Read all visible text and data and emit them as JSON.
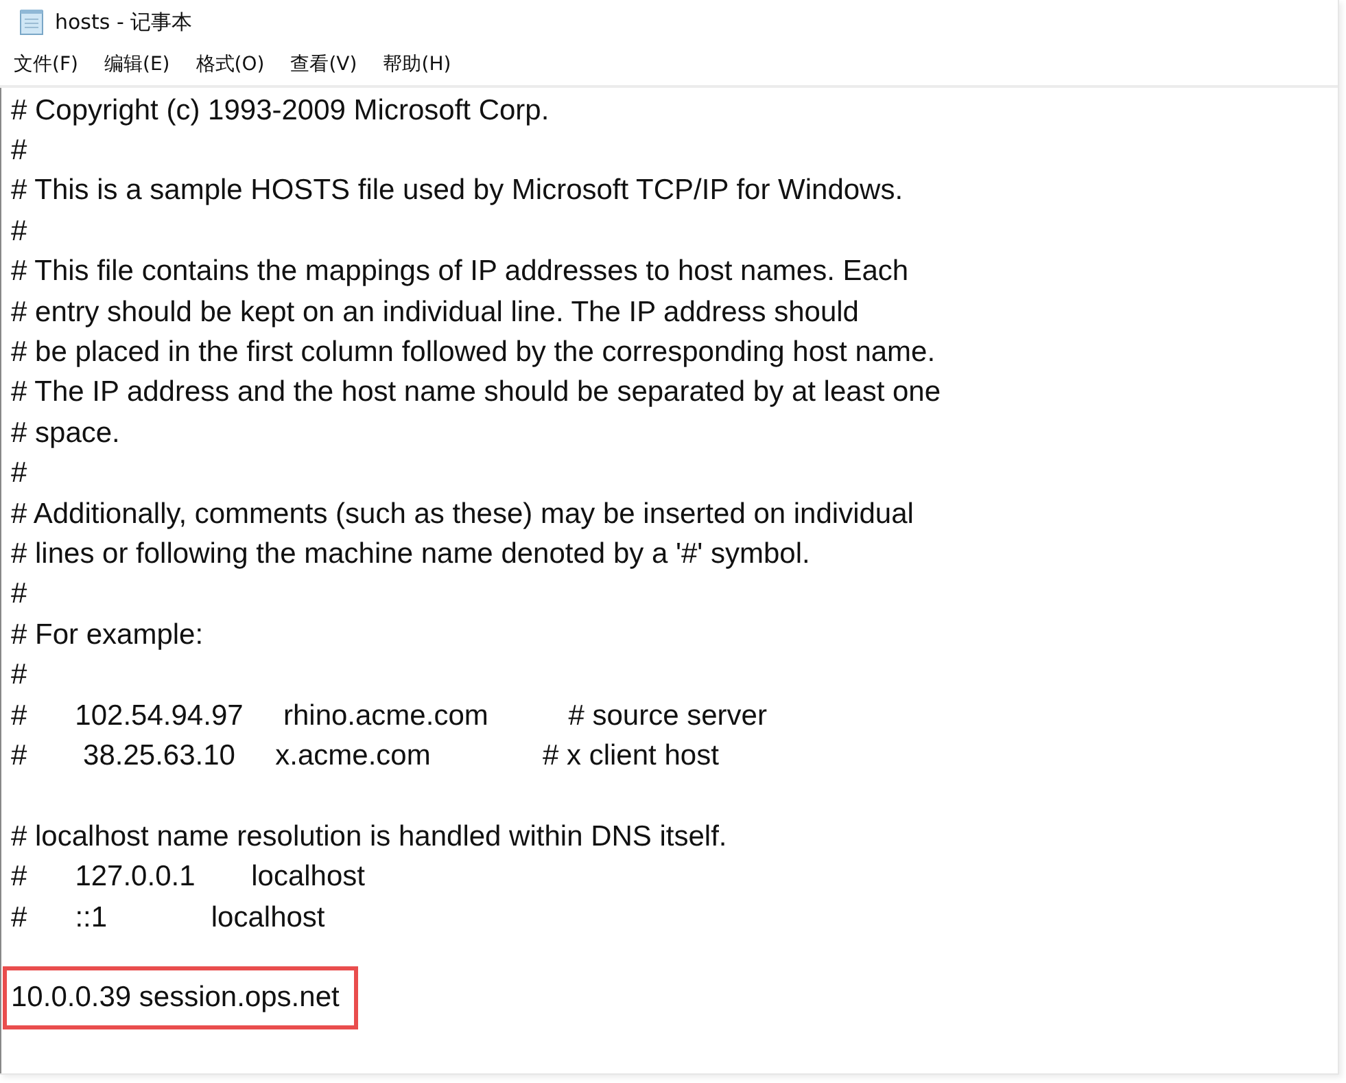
{
  "window": {
    "title": "hosts - 记事本"
  },
  "menu": [
    "文件(F)",
    "编辑(E)",
    "格式(O)",
    "查看(V)",
    "帮助(H)"
  ],
  "editor": {
    "lines": [
      {
        "kind": "text",
        "text": "# Copyright (c) 1993-2009 Microsoft Corp."
      },
      {
        "kind": "text",
        "text": "#"
      },
      {
        "kind": "text",
        "text": "# This is a sample HOSTS file used by Microsoft TCP/IP for Windows."
      },
      {
        "kind": "text",
        "text": "#"
      },
      {
        "kind": "text",
        "text": "# This file contains the mappings of IP addresses to host names. Each"
      },
      {
        "kind": "text",
        "text": "# entry should be kept on an individual line. The IP address should"
      },
      {
        "kind": "text",
        "text": "# be placed in the first column followed by the corresponding host name."
      },
      {
        "kind": "text",
        "text": "# The IP address and the host name should be separated by at least one"
      },
      {
        "kind": "text",
        "text": "# space."
      },
      {
        "kind": "text",
        "text": "#"
      },
      {
        "kind": "text",
        "text": "# Additionally, comments (such as these) may be inserted on individual"
      },
      {
        "kind": "text",
        "text": "# lines or following the machine name denoted by a '#' symbol."
      },
      {
        "kind": "text",
        "text": "#"
      },
      {
        "kind": "text",
        "text": "# For example:"
      },
      {
        "kind": "text",
        "text": "#"
      },
      {
        "kind": "text",
        "text": "#      102.54.94.97     rhino.acme.com          # source server"
      },
      {
        "kind": "text",
        "text": "#       38.25.63.10     x.acme.com              # x client host"
      },
      {
        "kind": "blank"
      },
      {
        "kind": "text",
        "text": "# localhost name resolution is handled within DNS itself."
      },
      {
        "kind": "text",
        "text": "#\t127.0.0.1       localhost"
      },
      {
        "kind": "text",
        "text": "#\t::1             localhost"
      },
      {
        "kind": "blank"
      },
      {
        "kind": "text",
        "text": "10.0.0.39 session.ops.net",
        "highlighted": true
      }
    ]
  }
}
